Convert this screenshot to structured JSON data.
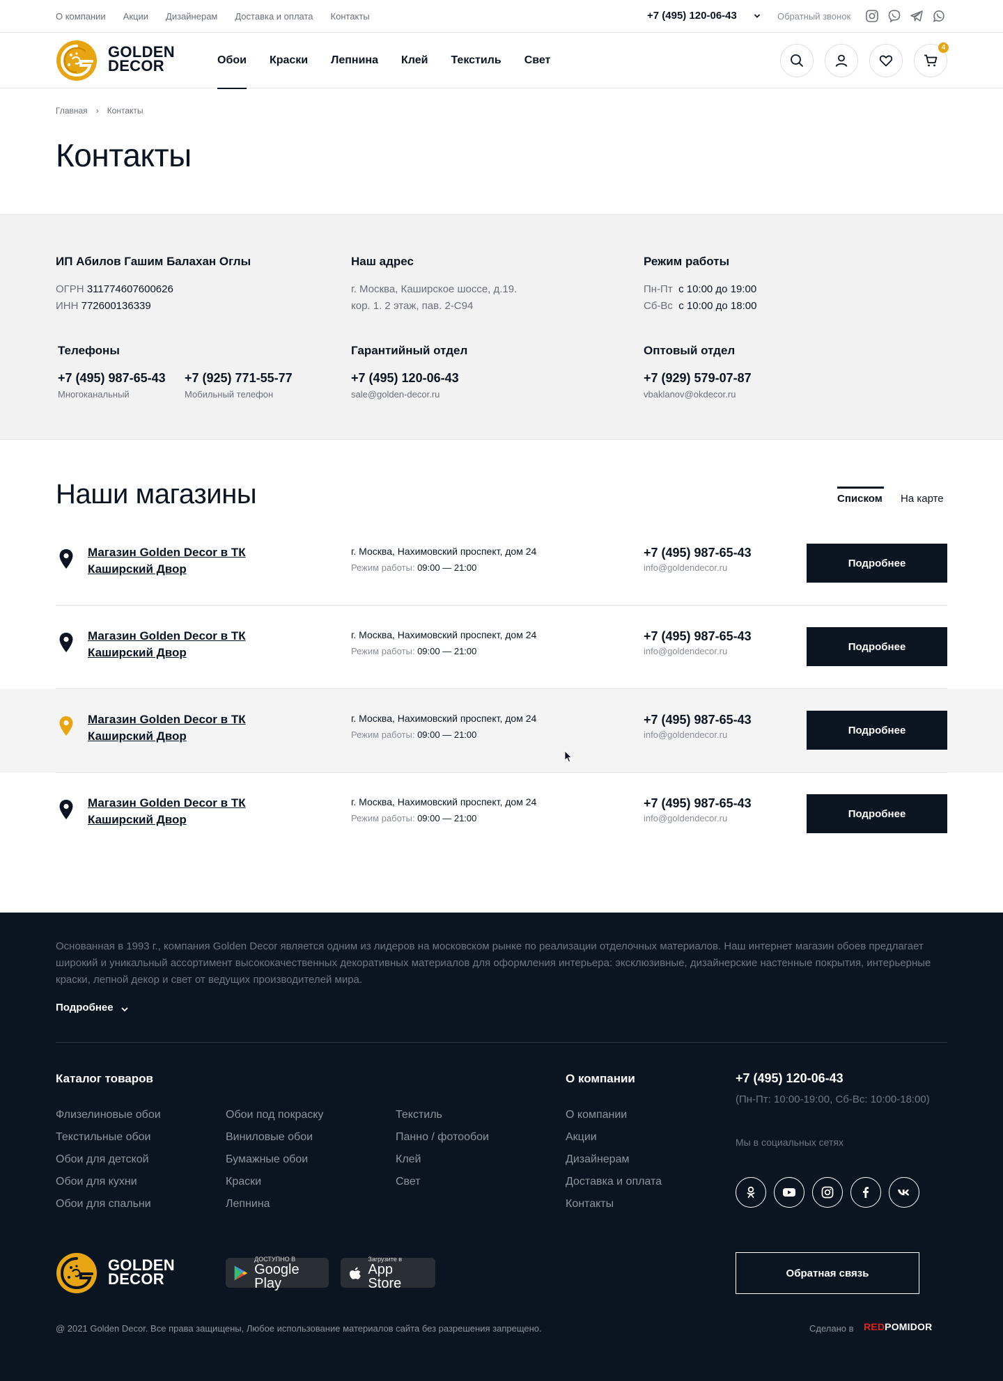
{
  "topbar": {
    "nav": [
      "О компании",
      "Акции",
      "Дизайнерам",
      "Доставка и оплата",
      "Контакты"
    ],
    "phone": "+7 (495) 120-06-43",
    "callback": "Обратный звонок",
    "social_icons": [
      "instagram-icon",
      "viber-icon",
      "telegram-icon",
      "whatsapp-icon"
    ]
  },
  "header": {
    "logo_line1": "GOLDEN",
    "logo_line2": "DECOR",
    "nav": [
      {
        "label": "Обои",
        "active": true
      },
      {
        "label": "Краски",
        "active": false
      },
      {
        "label": "Лепнина",
        "active": false
      },
      {
        "label": "Клей",
        "active": false
      },
      {
        "label": "Текстиль",
        "active": false
      },
      {
        "label": "Свет",
        "active": false
      }
    ],
    "cart_count": "4",
    "accent": "#e8a512"
  },
  "breadcrumb": {
    "home": "Главная",
    "sep": "›",
    "current": "Контакты"
  },
  "page_title": "Контакты",
  "company": {
    "name": "ИП Абилов Гашим Балахан Оглы",
    "ogrn_label": "ОГРН",
    "ogrn": "311774607600626",
    "inn_label": "ИНН",
    "inn": "772600136339"
  },
  "address": {
    "title": "Наш адрес",
    "line1": "г. Москва, Каширское шоссе, д.19.",
    "line2": "кор. 1. 2 этаж, пав. 2-С94"
  },
  "hours": {
    "title": "Режим работы",
    "weekdays_label": "Пн-Пт",
    "weekdays": "с 10:00 до 19:00",
    "weekend_label": "Сб-Вс",
    "weekend": "с 10:00 до 18:00"
  },
  "phones": {
    "title": "Телефоны",
    "main": "+7 (495) 987-65-43",
    "main_note": "Многоканальный",
    "mobile": "+7 (925) 771-55-77",
    "mobile_note": "Мобильный телефон"
  },
  "warranty": {
    "title": "Гарантийный отдел",
    "phone": "+7 (495) 120-06-43",
    "email": "sale@golden-decor.ru"
  },
  "wholesale": {
    "title": "Оптовый отдел",
    "phone": "+7 (929) 579-07-87",
    "email": "vbaklanov@okdecor.ru"
  },
  "stores_section": {
    "title": "Наши магазины",
    "view_list": "Списком",
    "view_map": "На карте"
  },
  "stores": [
    {
      "name": "Магазин Golden Decor в ТК Каширский Двор",
      "address": "г. Москва, Нахимовский проспект, дом 24",
      "hours_label": "Режим работы:",
      "hours": "09:00 — 21:00",
      "phone": "+7 (495) 987-65-43",
      "email": "info@goldendecor.ru",
      "button": "Подробнее",
      "highlighted": false
    },
    {
      "name": "Магазин Golden Decor в ТК Каширский Двор",
      "address": "г. Москва, Нахимовский проспект, дом 24",
      "hours_label": "Режим работы:",
      "hours": "09:00 — 21:00",
      "phone": "+7 (495) 987-65-43",
      "email": "info@goldendecor.ru",
      "button": "Подробнее",
      "highlighted": false
    },
    {
      "name": "Магазин Golden Decor в ТК Каширский Двор",
      "address": "г. Москва, Нахимовский проспект, дом 24",
      "hours_label": "Режим работы:",
      "hours": "09:00 — 21:00",
      "phone": "+7 (495) 987-65-43",
      "email": "info@goldendecor.ru",
      "button": "Подробнее",
      "highlighted": true
    },
    {
      "name": "Магазин Golden Decor в ТК Каширский Двор",
      "address": "г. Москва, Нахимовский проспект, дом 24",
      "hours_label": "Режим работы:",
      "hours": "09:00 — 21:00",
      "phone": "+7 (495) 987-65-43",
      "email": "info@goldendecor.ru",
      "button": "Подробнее",
      "highlighted": false
    }
  ],
  "footer": {
    "about": "Основанная в 1993 г., компания Golden Decor является одним из лидеров на московском рынке по реализации отделочных материалов. Наш интернет магазин обоев предлагает широкий и уникальный ассортимент высококачественных декоративных материалов для оформления интерьера: эксклюзивные, дизайнерские настенные покрытия, интерьерные краски, лепной декор и свет от ведущих производителей мира.",
    "more": "Подробнее",
    "catalog_title": "Каталог товаров",
    "catalog_col1": [
      "Флизелиновые обои",
      "Текстильные обои",
      "Обои для детской",
      "Обои для кухни",
      "Обои для спальни"
    ],
    "catalog_col2": [
      "Обои под покраску",
      "Виниловые обои",
      "Бумажные обои",
      "Краски",
      "Лепнина"
    ],
    "catalog_col3": [
      "Текстиль",
      "Панно / фотообои",
      "Клей",
      "Свет"
    ],
    "company_title": "О компании",
    "company_links": [
      "О компании",
      "Акции",
      "Дизайнерам",
      "Доставка и оплата",
      "Контакты"
    ],
    "phone": "+7 (495) 120-06-43",
    "phone_hours": "(Пн-Пт: 10:00-19:00, Сб-Вс: 10:00-18:00)",
    "social_label": "Мы в социальных сетях",
    "social_icons": [
      "odnoklassniki-icon",
      "youtube-icon",
      "instagram-icon",
      "facebook-icon",
      "vk-icon"
    ],
    "gp_small": "ДОСТУПНО В",
    "gp_big": "Google Play",
    "as_small": "Загрузите в",
    "as_big": "App Store",
    "feedback": "Обратная связь",
    "copyright": "@ 2021 Golden Decor. Все права защищены, Любое использование материалов сайта без разрешения запрещено.",
    "made_by": "Сделано в",
    "made_brand_red": "RED",
    "made_brand_white": "POMIDOR",
    "brand_red_color": "#e2231a"
  }
}
